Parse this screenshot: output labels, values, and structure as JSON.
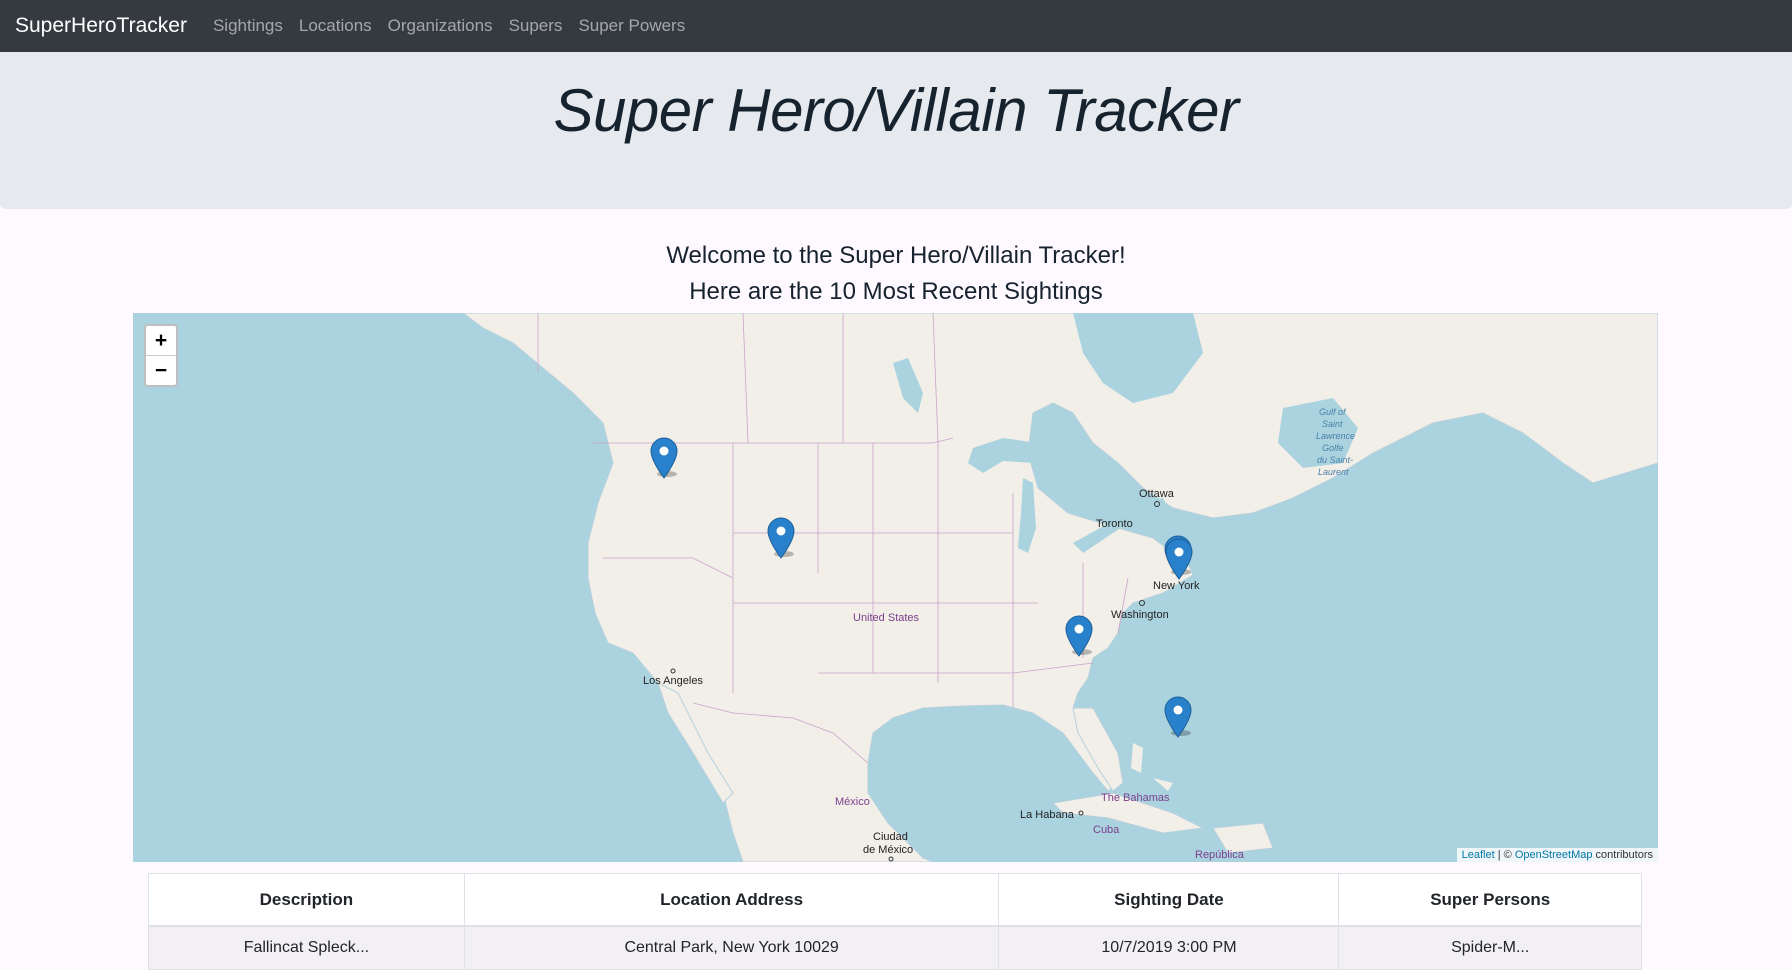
{
  "navbar": {
    "brand": "SuperHeroTracker",
    "links": [
      "Sightings",
      "Locations",
      "Organizations",
      "Supers",
      "Super Powers"
    ]
  },
  "jumbotron": {
    "title": "Super Hero/Villain Tracker"
  },
  "welcome": {
    "line1": "Welcome to the Super Hero/Villain Tracker!",
    "line2": "Here are the 10 Most Recent Sightings"
  },
  "map": {
    "zoom_in": "+",
    "zoom_out": "−",
    "labels": {
      "ottawa": "Ottawa",
      "toronto": "Toronto",
      "new_york": "New York",
      "washington": "Washington",
      "united_states": "United States",
      "los_angeles": "Los Angeles",
      "mexico": "México",
      "ciudad_de_mexico_1": "Ciudad",
      "ciudad_de_mexico_2": "de México",
      "la_habana": "La Habana",
      "bahamas": "The Bahamas",
      "cuba": "Cuba",
      "republica": "República",
      "gulf_1": "Gulf of",
      "gulf_2": "Saint",
      "gulf_3": "Lawrence",
      "gulf_4": "Golfe",
      "gulf_5": "du Saint-",
      "gulf_6": "Laurent"
    },
    "attribution": {
      "leaflet": "Leaflet",
      "sep": " | © ",
      "osm": "OpenStreetMap",
      "suffix": " contributors"
    }
  },
  "table": {
    "headers": [
      "Description",
      "Location Address",
      "Sighting Date",
      "Super Persons"
    ],
    "rows": [
      [
        "Fallincat Spleck...",
        "Central Park, New York 10029",
        "10/7/2019 3:00 PM",
        "Spider-M..."
      ]
    ]
  },
  "colors": {
    "navbar": "#343a40",
    "water": "#aad3df",
    "land": "#f2efe9",
    "marker": "#2a81cb"
  }
}
